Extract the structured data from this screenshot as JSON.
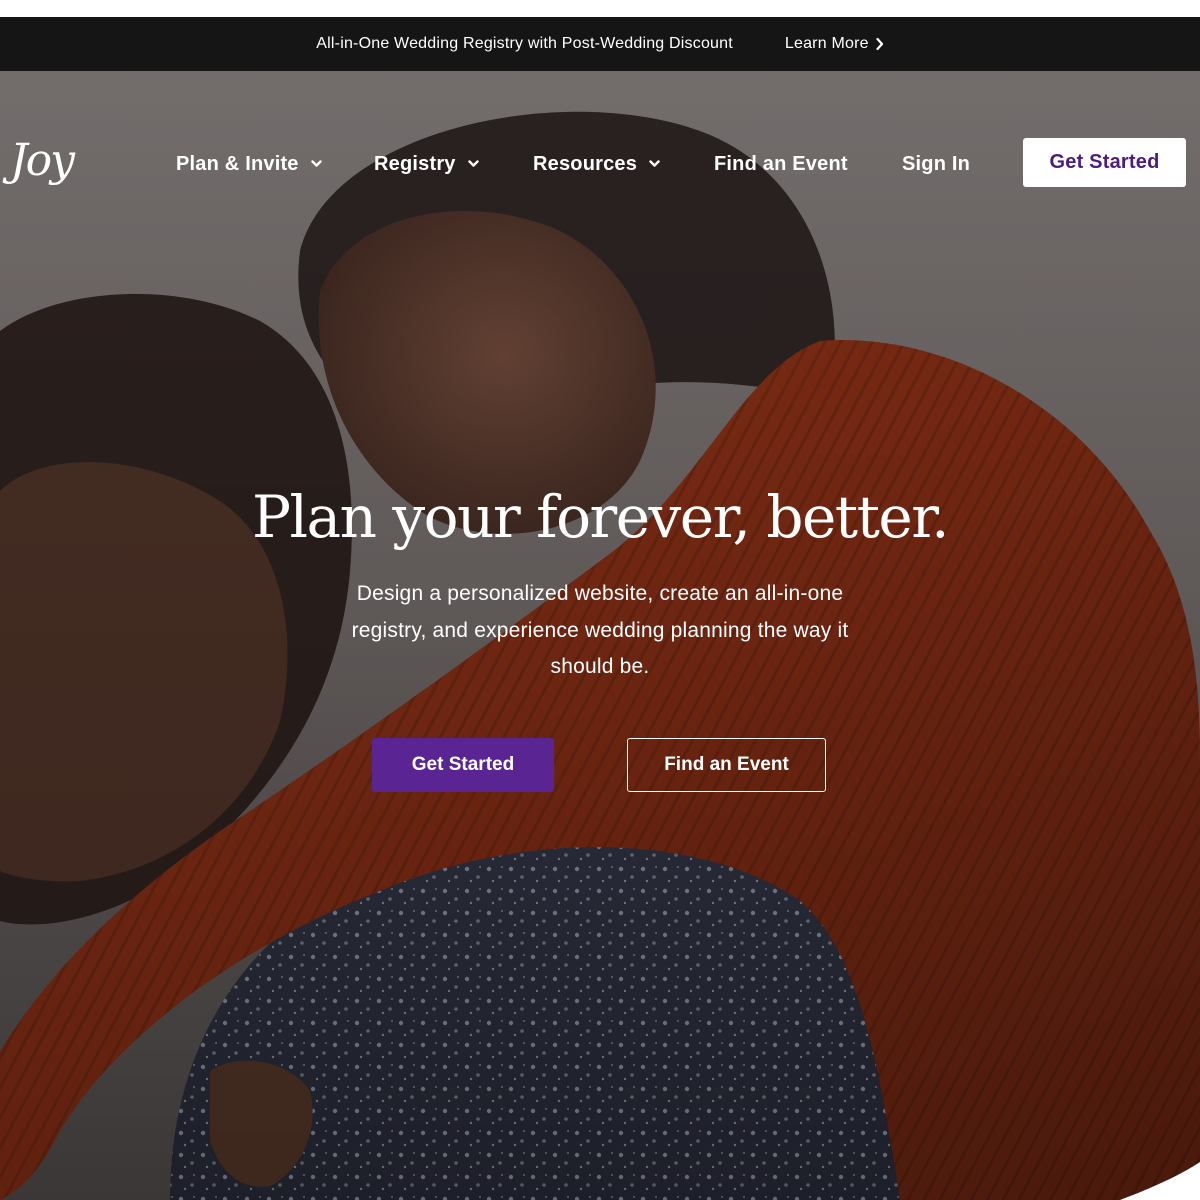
{
  "promo": {
    "text": "All-in-One Wedding Registry with Post-Wedding Discount",
    "link_label": "Learn More",
    "link_icon": "chevron-right-icon"
  },
  "nav": {
    "logo": "Joy",
    "items": [
      {
        "label": "Plan & Invite",
        "has_dropdown": true,
        "icon": "chevron-down-icon"
      },
      {
        "label": "Registry",
        "has_dropdown": true,
        "icon": "chevron-down-icon"
      },
      {
        "label": "Resources",
        "has_dropdown": true,
        "icon": "chevron-down-icon"
      },
      {
        "label": "Find an Event",
        "has_dropdown": false
      },
      {
        "label": "Sign In",
        "has_dropdown": false
      }
    ],
    "cta_label": "Get Started"
  },
  "hero": {
    "title": "Plan your forever, better.",
    "subtitle": "Design a personalized website, create an all-in-one registry, and experience wedding planning the way it should be.",
    "primary_button": "Get Started",
    "secondary_button": "Find an Event"
  },
  "colors": {
    "promo_bg": "#151515",
    "brand_purple": "#5a2493",
    "cta_text": "#4c1c83",
    "text_on_dark": "#ffffff"
  }
}
